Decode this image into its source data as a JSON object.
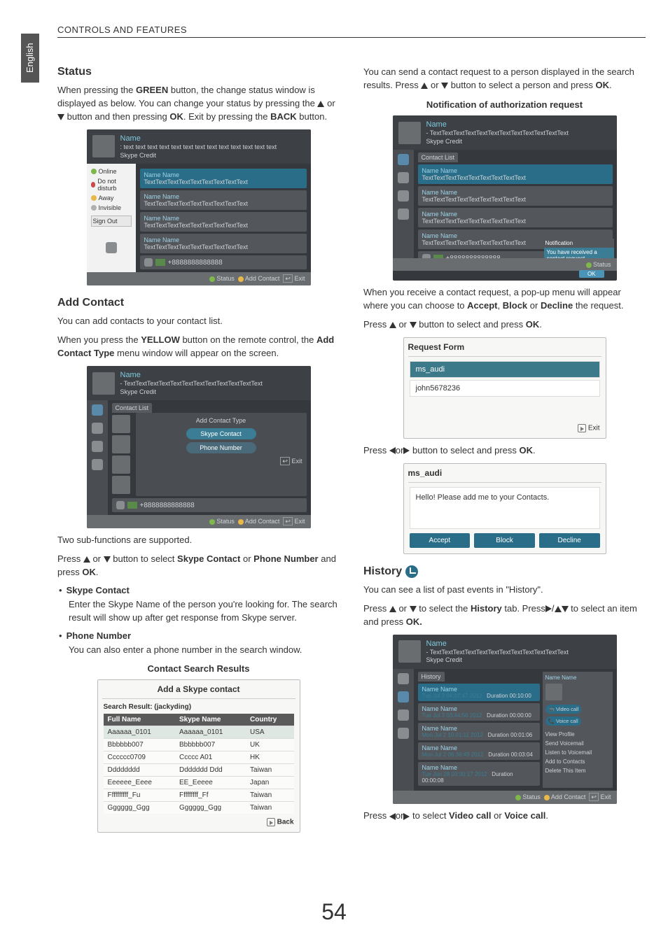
{
  "lang_tab": "English",
  "page_header": "CONTROLS AND FEATURES",
  "page_number": "54",
  "left": {
    "status_title": "Status",
    "status_text_a": "When pressing the ",
    "status_green": "GREEN",
    "status_text_b": " button, the change status window is displayed as below. You can change your status by pressing the ",
    "status_text_c": " or ",
    "status_text_d": " button and then pressing ",
    "status_ok": "OK",
    "status_text_e": ".  Exit by pressing the ",
    "status_back": "BACK",
    "status_text_f": " button.",
    "status_menu": {
      "online": "Online",
      "dnd": "Do not disturb",
      "away": "Away",
      "invisible": "Invisible",
      "sign_out": "Sign Out"
    },
    "panel_common": {
      "name": "Name",
      "mood": ": text text text text text text text text text text text text text",
      "skype_credit": "Skype Credit",
      "contact_list": "Contact List",
      "contact_name": "Name Name",
      "contact_sub": "TextTextTextTextTextTextTextTextText",
      "phone_num": "+8888888888888",
      "footer_status": "Status",
      "footer_add": "Add Contact",
      "footer_exit": "Exit"
    },
    "add_contact_title": "Add Contact",
    "add_contact_p1": "You can add contacts to your contact list.",
    "add_contact_p2a": "When you press the ",
    "add_contact_yellow": "YELLOW",
    "add_contact_p2b": " button on the remote control, the ",
    "add_contact_type": "Add Contact Type",
    "add_contact_p2c": " menu window will appear on the screen.",
    "add_type_menu": {
      "title": "Add Contact Type",
      "skype_contact": "Skype Contact",
      "phone_number": "Phone Number",
      "exit": "Exit"
    },
    "two_sub": "Two sub-functions are supported.",
    "press_a": "Press ",
    "press_or": " or ",
    "press_select": " button to select ",
    "skype_contact_b": "Skype Contact",
    "phone_number_b": "Phone Number",
    "press_and": " and press ",
    "press_ok": "OK",
    "sc_desc": "Enter the Skype Name of the person you're looking for. The search result will show up after get response from Skype server.",
    "pn_desc": "You can also enter a phone number in the search window.",
    "csr_title": "Contact Search Results",
    "csr_box": {
      "title": "Add a Skype contact",
      "search_label": "Search Result: (jackyding)",
      "headers": [
        "Full Name",
        "Skype Name",
        "Country"
      ],
      "rows": [
        [
          "Aaaaaa_0101",
          "Aaaaaa_0101",
          "USA"
        ],
        [
          "Bbbbbb007",
          "Bbbbbb007",
          "UK"
        ],
        [
          "Cccccc0709",
          "Ccccc A01",
          "HK"
        ],
        [
          "Dddddddd",
          "Ddddddd Ddd",
          "Taiwan"
        ],
        [
          "Eeeeee_Eeee",
          "EE_Eeeee",
          "Japan"
        ],
        [
          "Ffffffffff_Fu",
          "Fffffffff_Ff",
          "Taiwan"
        ],
        [
          "Gggggg_Ggg",
          "Gggggg_Ggg",
          "Taiwan"
        ]
      ],
      "back": "Back"
    }
  },
  "right": {
    "send_p_a": "You can send a contact request to a person displayed in the search results. Press ",
    "send_p_b": " or ",
    "send_p_c": " button to select a person and press ",
    "send_ok": "OK",
    "notif_title": "Notification of authorization request",
    "notif_box": {
      "title": "Notification",
      "msg": "You have received a contact request.",
      "ok": "OK"
    },
    "recv_p_a": "When you receive a contact request, a pop-up menu will appear where you can choose to ",
    "accept": "Accept",
    "block": "Block",
    "decline": "Decline",
    "recv_p_b": " the request.",
    "press_sel_ok_a": "Press ",
    "press_sel_ok_b": " or ",
    "press_sel_ok_c": " button to select and press ",
    "press_sel_ok_ok": "OK",
    "req_form": {
      "title": "Request Form",
      "item1": "ms_audi",
      "item2": "john5678236",
      "exit": "Exit"
    },
    "press_lr_a": "Press ",
    "press_lr_b": "or",
    "press_lr_c": " button to select and press ",
    "press_lr_ok": "OK",
    "msg_box": {
      "from": "ms_audi",
      "body": "Hello! Please add me to your Contacts.",
      "accept": "Accept",
      "block": "Block",
      "decline": "Decline"
    },
    "history_title": "History",
    "hist_p1": "You can see a list of past events in \"History\".",
    "hist_p2a": "Press ",
    "hist_p2b": " or ",
    "hist_p2c": " to select  the ",
    "hist_tab": "History",
    "hist_p2d": " tab.  Press",
    "hist_p2e": "/",
    "hist_p2f": " to select an item and press ",
    "hist_ok": "OK.",
    "hist_panel": {
      "tab": "History",
      "rows": [
        {
          "name": "Name Name",
          "time": "Tue Jul  3  04:07:47 2012",
          "dur": "Duration  00:10:00",
          "hl": true
        },
        {
          "name": "Name Name",
          "time": "Tue Jul  3  03:44:58 2012",
          "dur": "Duration  00:00:00"
        },
        {
          "name": "Name Name",
          "time": "Mon Jul  2  10:01:11 2012",
          "dur": "Duration  00:01:06"
        },
        {
          "name": "Name Name",
          "time": "Mon Jul  2  06:36:49 2012",
          "dur": "Duration  00:03:04"
        },
        {
          "name": "Name Name",
          "time": "Tue Jun  28  03:30:17 2012",
          "dur": "Duration  00:00:08"
        }
      ],
      "side": {
        "name": "Name Name",
        "video": "Video call",
        "voice": "Voice call",
        "view_profile": "View Profile",
        "send_vm": "Send Voicemail",
        "listen_vm": "Listen to Voicemail",
        "add_contacts": "Add to Contacts",
        "delete": "Delete This Item"
      }
    },
    "final_a": "Press ",
    "final_b": "or",
    "final_c": " to select ",
    "final_vc": "Video call",
    "final_d": " or ",
    "final_voice": "Voice call",
    "final_e": "."
  }
}
